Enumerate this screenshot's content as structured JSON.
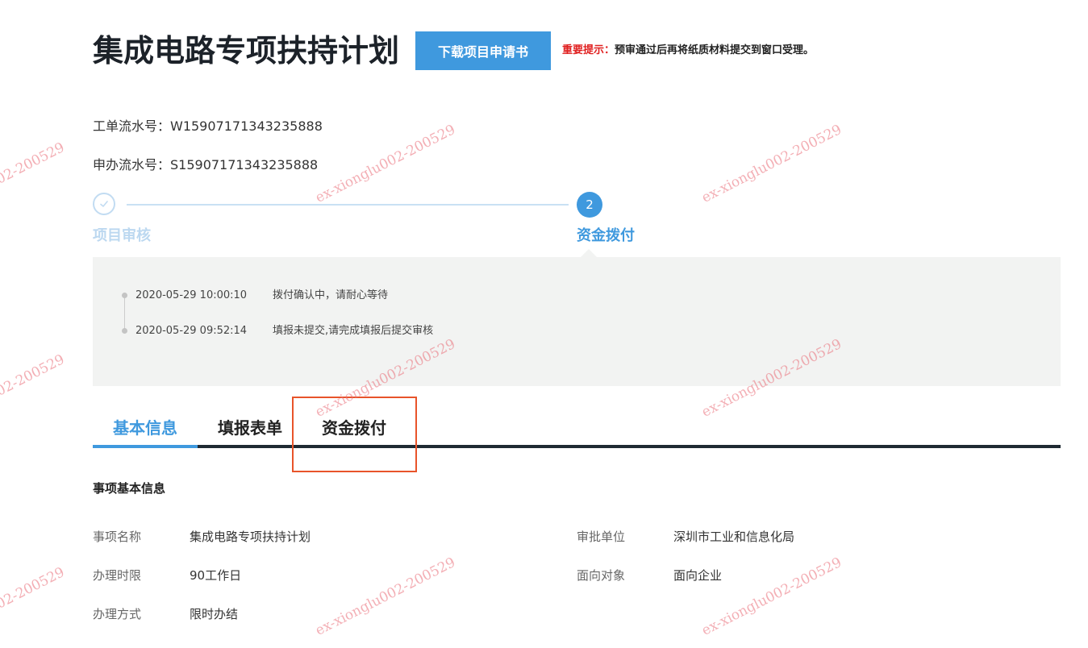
{
  "header": {
    "title": "集成电路专项扶持计划",
    "download_button": "下载项目申请书",
    "notice_label": "重要提示：",
    "notice_text": "预审通过后再将纸质材料提交到窗口受理。"
  },
  "serials": {
    "work_order": "工单流水号：W15907171343235888",
    "application": "申办流水号：S15907171343235888"
  },
  "steps": [
    {
      "label": "项目审核",
      "status": "done"
    },
    {
      "number": "2",
      "label": "资金拨付",
      "status": "active"
    }
  ],
  "timeline": [
    {
      "time": "2020-05-29 10:00:10",
      "message": "拨付确认中，请耐心等待"
    },
    {
      "time": "2020-05-29 09:52:14",
      "message": "填报未提交,请完成填报后提交审核"
    }
  ],
  "tabs": [
    {
      "label": "基本信息",
      "active": true
    },
    {
      "label": "填报表单",
      "active": false
    },
    {
      "label": "资金拨付",
      "active": false
    }
  ],
  "basic_info": {
    "section_title": "事项基本信息",
    "fields": [
      {
        "label": "事项名称",
        "value": "集成电路专项扶持计划"
      },
      {
        "label": "审批单位",
        "value": "深圳市工业和信息化局"
      },
      {
        "label": "办理时限",
        "value": "90工作日"
      },
      {
        "label": "面向对象",
        "value": "面向企业"
      },
      {
        "label": "办理方式",
        "value": "限时办结"
      }
    ]
  },
  "watermark": {
    "text": "ex-xionglu002-200529",
    "partial": "02-200529"
  },
  "colors": {
    "accent": "#3f99de",
    "notice_red": "#e02020",
    "highlight": "#e8542a",
    "watermark": "#e96e78"
  }
}
